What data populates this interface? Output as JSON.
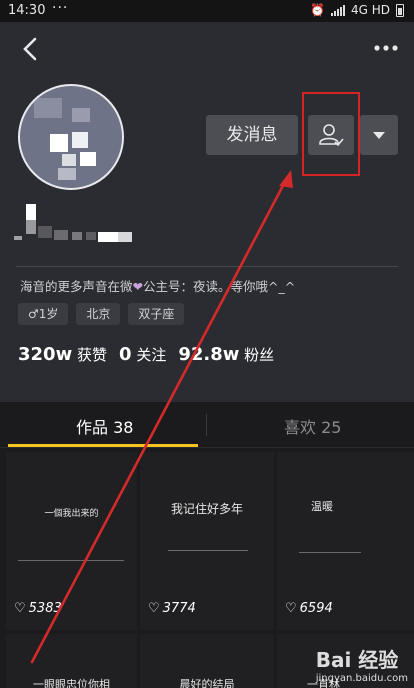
{
  "status_bar": {
    "time": "14:30",
    "network": "4G HD"
  },
  "profile": {
    "message_button": "发消息",
    "bio_before": "海音的更多声音在微",
    "bio_heart": "❤",
    "bio_after": "公主号：夜读。等你哦^_^",
    "tags": [
      "1岁",
      "北京",
      "双子座"
    ],
    "stats": {
      "likes_value": "320w",
      "likes_label": "获赞",
      "following_value": "0",
      "following_label": "关注",
      "followers_value": "92.8w",
      "followers_label": "粉丝"
    }
  },
  "tabs": {
    "works": "作品 38",
    "likes": "喜欢 25"
  },
  "videos": [
    {
      "caption": "一個我出来的",
      "likes": "5383"
    },
    {
      "caption": "我记住好多年",
      "likes": "3774"
    },
    {
      "caption": "温暖",
      "likes": "6594"
    },
    {
      "caption": "一眼眼忠位你相",
      "likes": ""
    },
    {
      "caption": "晨好的结局",
      "likes": ""
    },
    {
      "caption": "一直林",
      "likes": ""
    }
  ],
  "watermark": {
    "logo": "Bai 经验",
    "url": "jingyan.baidu.com"
  }
}
